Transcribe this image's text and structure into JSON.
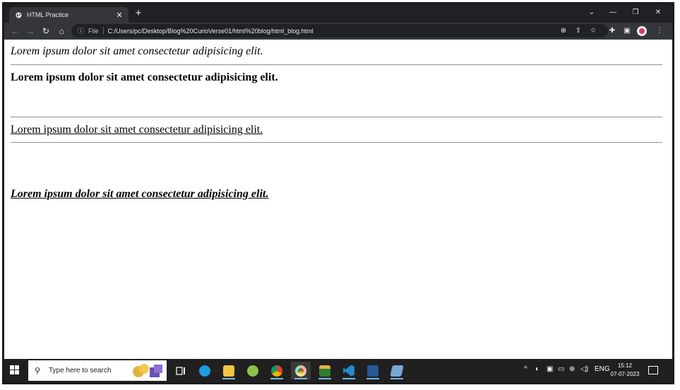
{
  "browser": {
    "tab_title": "HTML Practice",
    "tab_close": "✕",
    "new_tab": "+",
    "url_scheme": "File",
    "url": "C:/Users/pc/Desktop/Blog%20CurioVerse01/html%20blog/html_blog.html",
    "window_controls": {
      "chevron": "⌄",
      "minimize": "—",
      "restore": "❐",
      "close": "✕"
    },
    "icons": [
      "back-icon",
      "forward-icon",
      "reload-icon",
      "home-icon",
      "info-icon",
      "zoom-icon",
      "share-icon",
      "bookmark-star-icon",
      "extensions-icon",
      "side-panel-icon",
      "profile-avatar",
      "more-menu-icon"
    ]
  },
  "page": {
    "line1": "Lorem ipsum dolor sit amet consectetur adipisicing elit.",
    "line2": "Lorem ipsum dolor sit amet consectetur adipisicing elit.",
    "line3": "Lorem ipsum dolor sit amet consectetur adipisicing elit.",
    "line4": "Lorem ipsum dolor sit amet consectetur adipisicing elit."
  },
  "taskbar": {
    "search_placeholder": "Type here to search",
    "language": "ENG",
    "time": "15:12",
    "date": "07-07-2023",
    "apps": [
      "task-view",
      "edge",
      "file-explorer",
      "app-green",
      "chrome",
      "chrome-active",
      "app-books",
      "vscode",
      "word",
      "app-notepad"
    ],
    "colors": {
      "edge": "#1b9de2",
      "file-explorer": "#f5c342",
      "app-green": "#8bc34a",
      "chrome": "#db4437",
      "chrome-active": "#db4437",
      "app-books": "#2e7d32",
      "vscode": "#2489ca",
      "word": "#2b579a",
      "app-notepad": "#7aa7d6"
    }
  }
}
